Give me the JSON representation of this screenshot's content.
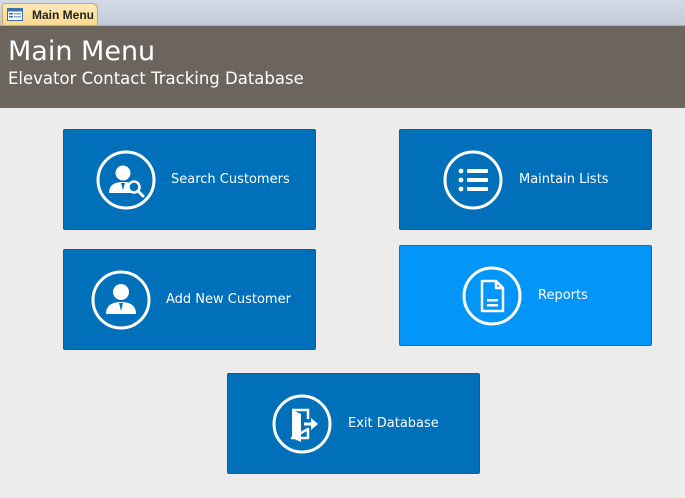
{
  "tab": {
    "label": "Main Menu",
    "icon": "form-icon"
  },
  "header": {
    "title": "Main Menu",
    "subtitle": "Elevator Contact Tracking Database",
    "bg_color": "#6c655e"
  },
  "buttons": {
    "search_customers": {
      "label": "Search Customers",
      "icon": "user-search-icon"
    },
    "add_new_customer": {
      "label": "Add New Customer",
      "icon": "user-icon"
    },
    "maintain_lists": {
      "label": "Maintain Lists",
      "icon": "list-icon"
    },
    "reports": {
      "label": "Reports",
      "icon": "document-icon"
    },
    "exit_database": {
      "label": "Exit Database",
      "icon": "exit-door-icon"
    }
  },
  "colors": {
    "button": "#0170bb",
    "button_active": "#0196f8",
    "background": "#ececec"
  }
}
